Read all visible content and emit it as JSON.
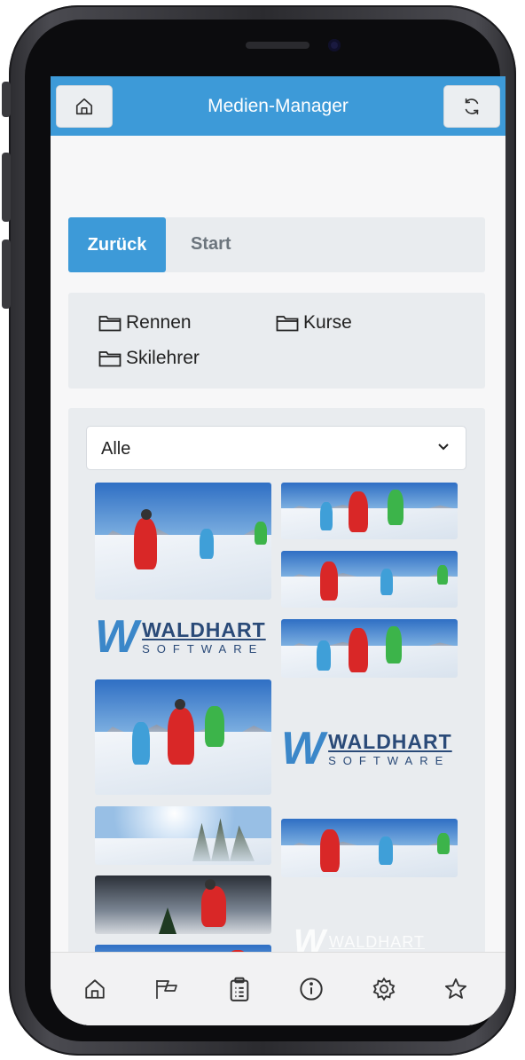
{
  "header": {
    "title": "Medien-Manager",
    "home_icon": "home-icon",
    "refresh_icon": "refresh-icon",
    "accent": "#3d9ad8"
  },
  "breadcrumb": {
    "back_label": "Zurück",
    "current_label": "Start"
  },
  "folders": [
    {
      "label": "Rennen",
      "icon": "folder-icon"
    },
    {
      "label": "Kurse",
      "icon": "folder-icon"
    },
    {
      "label": "Skilehrer",
      "icon": "folder-icon"
    }
  ],
  "filter": {
    "selected": "Alle",
    "icon": "chevron-down-icon"
  },
  "logo": {
    "main": "WALDHART",
    "sub": "SOFTWARE"
  },
  "bottom_nav": [
    {
      "icon": "home-icon"
    },
    {
      "icon": "flag-icon"
    },
    {
      "icon": "clipboard-icon"
    },
    {
      "icon": "info-icon"
    },
    {
      "icon": "gear-icon"
    },
    {
      "icon": "star-icon"
    }
  ]
}
